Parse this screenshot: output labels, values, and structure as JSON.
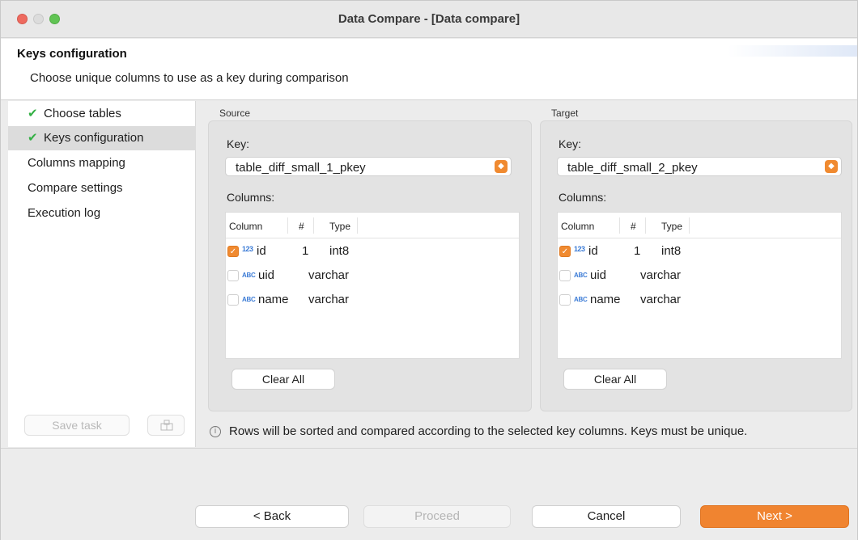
{
  "window": {
    "title": "Data Compare - [Data compare]"
  },
  "header": {
    "title": "Keys configuration",
    "description": "Choose unique columns to use as a key during comparison"
  },
  "sidebar": {
    "items": [
      {
        "label": "Choose tables",
        "done": true,
        "active": false
      },
      {
        "label": "Keys configuration",
        "done": true,
        "active": true
      },
      {
        "label": "Columns mapping",
        "done": false,
        "active": false
      },
      {
        "label": "Compare settings",
        "done": false,
        "active": false
      },
      {
        "label": "Execution log",
        "done": false,
        "active": false
      }
    ],
    "save_task": "Save task",
    "check_icon": "checkmark-icon"
  },
  "source": {
    "section": "Source",
    "key_label": "Key:",
    "key_value": "table_diff_small_1_pkey",
    "columns_label": "Columns:",
    "headers": {
      "column": "Column",
      "num": "#",
      "type": "Type"
    },
    "rows": [
      {
        "name": "id",
        "num": "1",
        "type": "int8",
        "checked": true,
        "kind": "numeric"
      },
      {
        "name": "uid",
        "num": "",
        "type": "varchar",
        "checked": false,
        "kind": "text"
      },
      {
        "name": "name",
        "num": "",
        "type": "varchar",
        "checked": false,
        "kind": "text"
      }
    ],
    "clear_all": "Clear All"
  },
  "target": {
    "section": "Target",
    "key_label": "Key:",
    "key_value": "table_diff_small_2_pkey",
    "columns_label": "Columns:",
    "headers": {
      "column": "Column",
      "num": "#",
      "type": "Type"
    },
    "rows": [
      {
        "name": "id",
        "num": "1",
        "type": "int8",
        "checked": true,
        "kind": "numeric"
      },
      {
        "name": "uid",
        "num": "",
        "type": "varchar",
        "checked": false,
        "kind": "text"
      },
      {
        "name": "name",
        "num": "",
        "type": "varchar",
        "checked": false,
        "kind": "text"
      }
    ],
    "clear_all": "Clear All"
  },
  "type_icons": {
    "numeric": "123",
    "text": "ABC"
  },
  "info": "Rows will be sorted and compared according to the selected key columns. Keys must be unique.",
  "footer": {
    "back": "< Back",
    "proceed": "Proceed",
    "cancel": "Cancel",
    "next": "Next >"
  },
  "colors": {
    "accent": "#f08430",
    "check_green": "#34b045",
    "type_icon_blue": "#3b7bd6"
  }
}
